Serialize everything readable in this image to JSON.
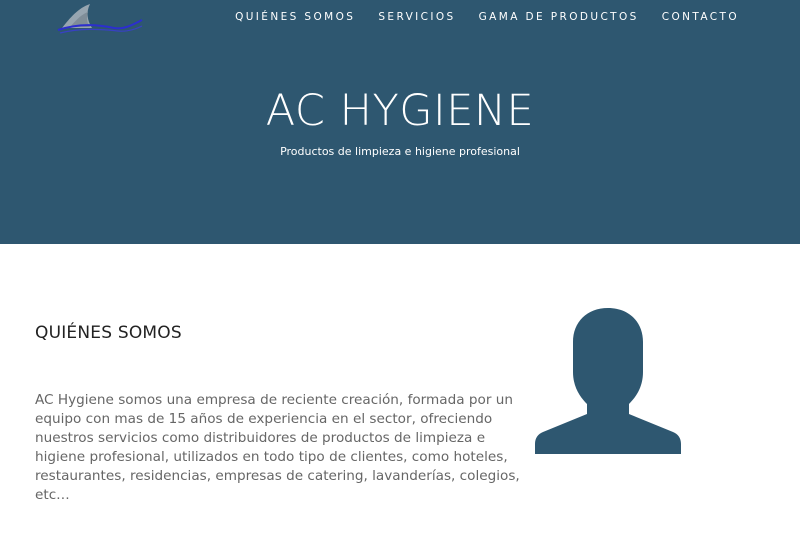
{
  "header": {
    "logo_icon": "shark-fin-wave-logo",
    "nav": [
      {
        "label": "QUIÉNES SOMOS"
      },
      {
        "label": "SERVICIOS"
      },
      {
        "label": "GAMA DE PRODUCTOS"
      },
      {
        "label": "CONTACTO"
      }
    ]
  },
  "hero": {
    "title": "AC HYGIENE",
    "subtitle": "Productos de limpieza e higiene profesional",
    "background_color": "#2e5770"
  },
  "about": {
    "title": "QUIÉNES SOMOS",
    "body": "AC Hygiene somos una empresa de reciente creación, formada por un equipo con mas de 15 años de experiencia en el sector, ofreciendo nuestros servicios como distribuidores de productos de limpieza e higiene profesional, utilizados en todo tipo de clientes, como hoteles, restaurantes, residencias, empresas de catering, lavanderías, colegios, etc…",
    "image_icon": "person-silhouette-icon",
    "image_color": "#2e5770"
  }
}
